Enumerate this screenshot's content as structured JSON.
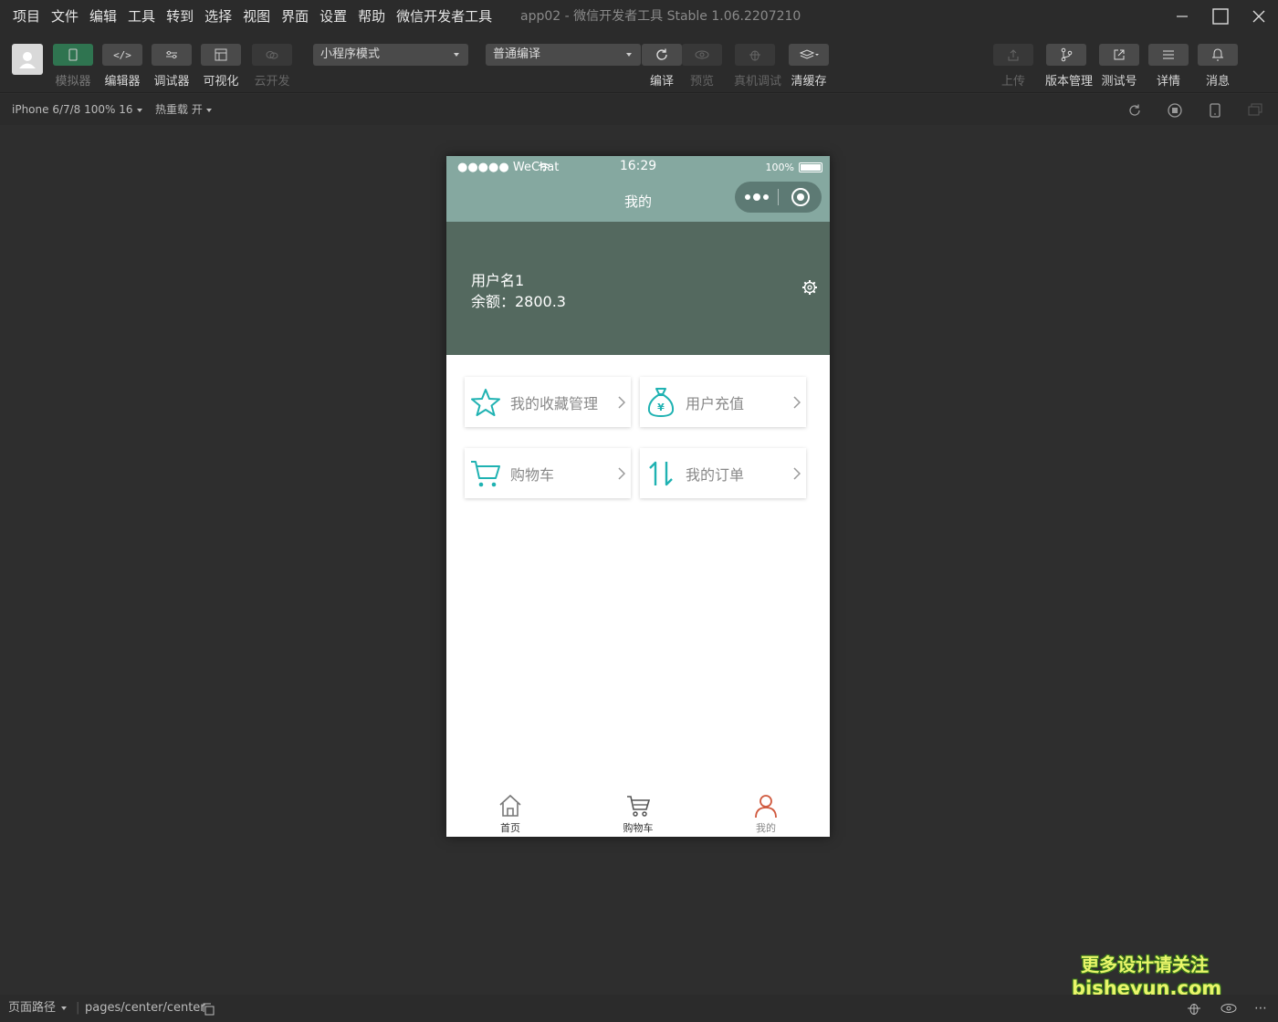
{
  "menu": [
    "项目",
    "文件",
    "编辑",
    "工具",
    "转到",
    "选择",
    "视图",
    "界面",
    "设置",
    "帮助",
    "微信开发者工具"
  ],
  "window_title": "app02 - 微信开发者工具 Stable 1.06.2207210",
  "toolbar": {
    "simulator": "模拟器",
    "editor": "编辑器",
    "debugger": "调试器",
    "visual": "可视化",
    "cloud": "云开发",
    "mode_select": "小程序模式",
    "compile_select": "普通编译",
    "compile": "编译",
    "preview": "预览",
    "device_debug": "真机调试",
    "clear_cache": "清缓存",
    "upload": "上传",
    "version": "版本管理",
    "test_account": "测试号",
    "details": "详情",
    "messages": "消息"
  },
  "subbar": {
    "device": "iPhone 6/7/8 100% 16",
    "hot_reload": "热重载 开"
  },
  "phone": {
    "carrier": "●●●●● WeChat",
    "time": "16:29",
    "battery": "100%",
    "nav_title": "我的",
    "username": "用户名1",
    "balance": "余额：2800.3",
    "cards": [
      {
        "label": "我的收藏管理",
        "icon": "star-icon"
      },
      {
        "label": "用户充值",
        "icon": "money-bag-icon"
      },
      {
        "label": "购物车",
        "icon": "cart-icon"
      },
      {
        "label": "我的订单",
        "icon": "sort-arrows-icon"
      }
    ],
    "tabs": [
      "首页",
      "购物车",
      "我的"
    ]
  },
  "bottombar": {
    "path_label": "页面路径",
    "path": "pages/center/center"
  },
  "watermark": {
    "line1": "更多设计请关注",
    "line2": "bisheyun.com"
  },
  "colors": {
    "accent": "#85a8a0",
    "header_bg": "#54695f",
    "icon_teal": "#1fb2b2",
    "active_tab": "#d0593e"
  }
}
